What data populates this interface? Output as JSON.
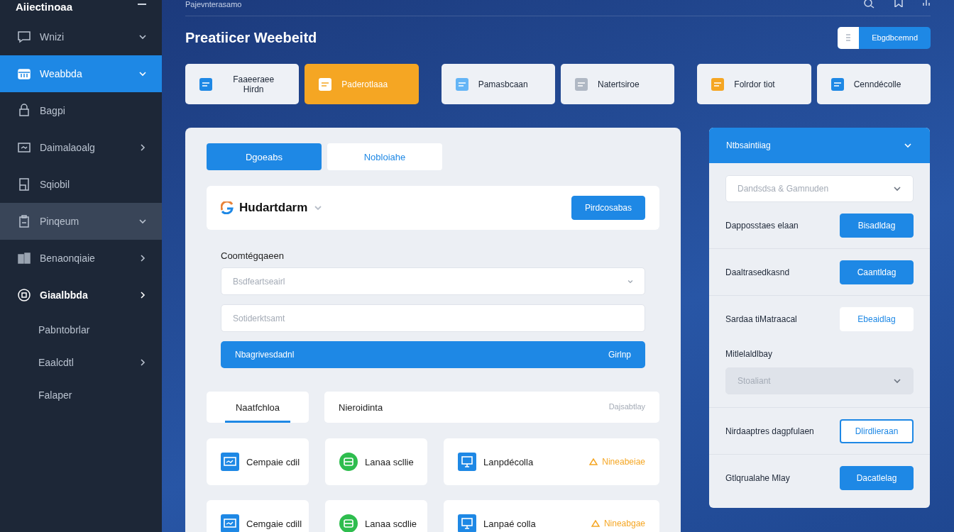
{
  "sidebar": {
    "title": "Aiiectinoaa",
    "items": [
      {
        "label": "Wnizi",
        "kind": "dropdown",
        "selected": false,
        "highlighted": false
      },
      {
        "label": "Weabbda",
        "kind": "dropdown",
        "selected": true,
        "highlighted": false
      },
      {
        "label": "Bagpi",
        "kind": "plain",
        "selected": false,
        "highlighted": false
      },
      {
        "label": "Daimalaoalg",
        "kind": "submenu",
        "selected": false,
        "highlighted": false
      },
      {
        "label": "Sqiobil",
        "kind": "plain",
        "selected": false,
        "highlighted": false
      },
      {
        "label": "Pinqeum",
        "kind": "dropdown",
        "selected": false,
        "highlighted": true
      },
      {
        "label": "Benaonqiaie",
        "kind": "submenu",
        "selected": false,
        "highlighted": false
      },
      {
        "label": "Giaalbbda",
        "kind": "submenu",
        "selected": false,
        "highlighted": false,
        "expanded": true,
        "children": [
          {
            "label": "Pabntobrlar",
            "kind": "plain"
          },
          {
            "label": "Eaalcdtl",
            "kind": "submenu"
          },
          {
            "label": "Falaper",
            "kind": "plain"
          }
        ]
      }
    ]
  },
  "top_bar": {
    "breadcrumb": "Pajevnterasamo"
  },
  "page": {
    "title": "Preatiicer Weebeitd",
    "toggle_button": "Ebgdbcemnd"
  },
  "quick_cards": [
    {
      "label": "Faaeeraee Hirdn",
      "color": "#1e88e5",
      "selected": false
    },
    {
      "label": "Paderotlaaa",
      "color": "#ffffff",
      "selected": true
    },
    {
      "label": "Pamasbcaan",
      "color": "#64b5f6",
      "selected": false
    },
    {
      "label": "Natertsiroe",
      "color": "#b0b8c4",
      "selected": false
    },
    {
      "label": "Folrdor tiot",
      "color": "#f5a623",
      "selected": false
    },
    {
      "label": "Cenndécolle",
      "color": "#1e88e5",
      "selected": false
    }
  ],
  "main_panel": {
    "tabs": [
      {
        "label": "Dgoeabs",
        "selected": true
      },
      {
        "label": "Nobloiahe",
        "selected": false
      }
    ],
    "project": {
      "name": "Hudartdarm",
      "button": "Pirdcosabas"
    },
    "form_label": "Coomtégqaeen",
    "select_placeholder": "Bsdfeartseairl",
    "input_placeholder": "Sotiderktsamt",
    "action_bar": {
      "label": "Nbagrivesdadnl",
      "action": "Girlnp"
    },
    "sub_tabs": [
      {
        "label": "Naatfchloa",
        "selected": true
      },
      {
        "label": "Nieroidinta",
        "selected": false
      }
    ],
    "sub_tabs_side": "Dajsabtlay",
    "tiles": [
      {
        "label": "Cempaie cdil",
        "color": "#1e88e5"
      },
      {
        "label": "Lanaa scllie",
        "color": "#2ebd4e"
      },
      {
        "label": "Lanpdécolla",
        "color": "#1e88e5",
        "note": "Nineabeiae"
      },
      {
        "label": "Cemgaie cdill",
        "color": "#1e88e5"
      },
      {
        "label": "Lanaa scdlie",
        "color": "#2ebd4e"
      },
      {
        "label": "Lanpaé colla",
        "color": "#1e88e5",
        "note": "Nineabgae"
      }
    ]
  },
  "right_panel": {
    "title": "Ntbsaintiiag",
    "select_placeholder": "Dandsdsa & Gamnuden",
    "rows": [
      {
        "kind": "action",
        "label": "Dapposstaes elaan",
        "button": {
          "label": "Bisadldag",
          "kind": "primary"
        }
      },
      {
        "kind": "action",
        "label": "Daaltrasedkasnd",
        "button": {
          "label": "Caantldag",
          "kind": "primary"
        }
      },
      {
        "kind": "action",
        "label": "Sardaa tiMatraacal",
        "button": {
          "label": "Ebeaidlag",
          "kind": "secondary"
        }
      },
      {
        "kind": "select",
        "label": "Mitlelaldlbay",
        "placeholder": "Stoaliant",
        "disabled": true
      },
      {
        "kind": "action",
        "label": "Nirdaaptres dagpfulaen",
        "button": {
          "label": "Dlirdlieraan",
          "kind": "outline"
        }
      },
      {
        "kind": "action",
        "label": "Gtlqrualahe Mlay",
        "button": {
          "label": "Dacatlelag",
          "kind": "primary"
        }
      }
    ]
  }
}
